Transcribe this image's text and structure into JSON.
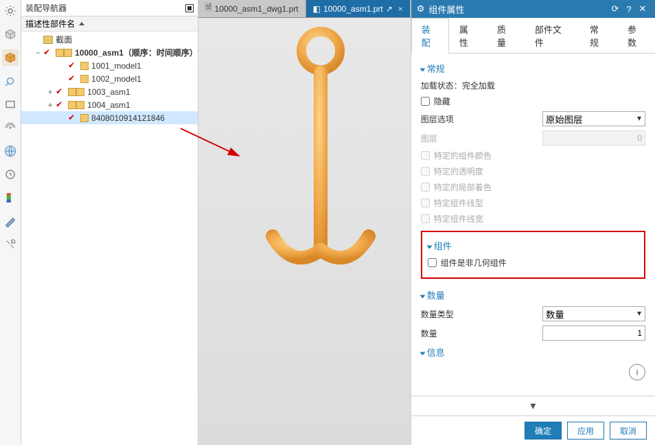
{
  "navigator": {
    "title": "装配导航器",
    "column_label": "描述性部件名",
    "root_section": "截面",
    "assembly_label": "10000_asm1",
    "assembly_suffix": "（顺序：时间顺序）",
    "nodes": [
      {
        "label": "1001_model1"
      },
      {
        "label": "1002_model1"
      },
      {
        "label": "1003_asm1"
      },
      {
        "label": "1004_asm1"
      },
      {
        "label": "8408010914121846"
      }
    ]
  },
  "tabs": [
    {
      "label": "10000_asm1_dwg1.prt"
    },
    {
      "label": "10000_asm1.prt"
    }
  ],
  "panel": {
    "title": "组件属性",
    "tabs": [
      "装配",
      "属性",
      "质量",
      "部件文件",
      "常规",
      "参数"
    ],
    "section_general": "常规",
    "load_state_label": "加载状态：",
    "load_state_value": "完全加载",
    "hidden_label": "隐藏",
    "layer_option_label": "图层选项",
    "layer_option_value": "原始图层",
    "layer_label": "图层",
    "layer_value": "0",
    "specific_color": "特定的组件颜色",
    "specific_trans": "特定的透明度",
    "specific_partial": "特定的局部着色",
    "specific_linetype": "特定组件线型",
    "specific_linewidth": "特定组件线宽",
    "section_component": "组件",
    "non_geometric_label": "组件是非几何组件",
    "section_quantity": "数量",
    "qty_type_label": "数量类型",
    "qty_type_value": "数量",
    "qty_label": "数量",
    "qty_value": "1",
    "section_info": "信息",
    "ok": "确定",
    "apply": "应用",
    "cancel": "取消"
  }
}
